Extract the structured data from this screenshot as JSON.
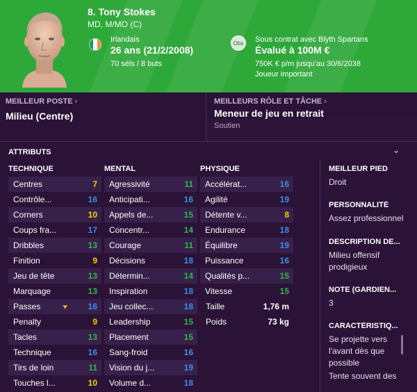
{
  "player": {
    "name": "8. Tony Stokes",
    "positions": "MD, M/MO (C)",
    "nationality": "Irlandais",
    "age": "26 ans (21/2/2008)",
    "caps": "70 séls / 8 buts",
    "obs_badge": "Obs",
    "contract": "Sous contrat avec Blyth Spartans",
    "value": "Évalué à 100M €",
    "wage": "750K € p/m jusqu'au 30/6/2038",
    "status": "Joueur important",
    "flag_colors": [
      "#169b62",
      "#ffffff",
      "#ff883e"
    ],
    "header_color": "#2fa83a"
  },
  "best_position": {
    "label": "MEILLEUR POSTE",
    "value": "Milieu (Centre)"
  },
  "best_role": {
    "label": "MEILLEURS RÔLE ET TÂCHE",
    "value": "Meneur de jeu en retrait",
    "duty": "Soutien"
  },
  "attributes": {
    "title": "ATTRIBUTS",
    "toggle_icon": "chevron-down-icon",
    "technique": {
      "header": "TECHNIQUE",
      "rows": [
        {
          "name": "Centres",
          "value": "7"
        },
        {
          "name": "Contrôle...",
          "value": "16"
        },
        {
          "name": "Corners",
          "value": "10"
        },
        {
          "name": "Coups fra...",
          "value": "17"
        },
        {
          "name": "Dribbles",
          "value": "13"
        },
        {
          "name": "Finition",
          "value": "9"
        },
        {
          "name": "Jeu de tête",
          "value": "13"
        },
        {
          "name": "Marquage",
          "value": "13"
        },
        {
          "name": "Passes",
          "value": "16"
        },
        {
          "name": "Penalty",
          "value": "9"
        },
        {
          "name": "Tacles",
          "value": "13"
        },
        {
          "name": "Technique",
          "value": "16"
        },
        {
          "name": "Tirs de loin",
          "value": "11"
        },
        {
          "name": "Touches l...",
          "value": "10"
        }
      ]
    },
    "mental": {
      "header": "MENTAL",
      "rows": [
        {
          "name": "Agressivité",
          "value": "11"
        },
        {
          "name": "Anticipati...",
          "value": "16"
        },
        {
          "name": "Appels de...",
          "value": "15"
        },
        {
          "name": "Concentr...",
          "value": "14"
        },
        {
          "name": "Courage",
          "value": "11"
        },
        {
          "name": "Décisions",
          "value": "18"
        },
        {
          "name": "Détermin...",
          "value": "14"
        },
        {
          "name": "Inspiration",
          "value": "18"
        },
        {
          "name": "Jeu collec...",
          "value": "18"
        },
        {
          "name": "Leadership",
          "value": "15"
        },
        {
          "name": "Placement",
          "value": "15"
        },
        {
          "name": "Sang-froid",
          "value": "16"
        },
        {
          "name": "Vision du j...",
          "value": "19"
        },
        {
          "name": "Volume d...",
          "value": "18"
        }
      ]
    },
    "physique": {
      "header": "PHYSIQUE",
      "rows": [
        {
          "name": "Accélérat...",
          "value": "16"
        },
        {
          "name": "Agilité",
          "value": "19"
        },
        {
          "name": "Détente v...",
          "value": "8"
        },
        {
          "name": "Endurance",
          "value": "18"
        },
        {
          "name": "Équilibre",
          "value": "19"
        },
        {
          "name": "Puissance",
          "value": "16"
        },
        {
          "name": "Qualités p...",
          "value": "15"
        },
        {
          "name": "Vitesse",
          "value": "15"
        }
      ],
      "height_label": "Taille",
      "height_value": "1,76 m",
      "weight_label": "Poids",
      "weight_value": "73 kg"
    }
  },
  "side_info": {
    "foot_label": "MEILLEUR PIED",
    "foot_value": "Droit",
    "personality_label": "PERSONNALITÉ",
    "personality_value": "Assez professionnel",
    "media_label": "DESCRIPTION DE...",
    "media_value": "Milieu offensif prodigieux",
    "rating_label": "NOTE (GARDIEN...",
    "rating_value": "3",
    "traits_label": "CARACTÉRISTIQ...",
    "traits": [
      "Se projette vers l'avant dès que possible",
      "Tente souvent des"
    ]
  },
  "value_colors": {
    "low": "#f0d000",
    "mid": "#2fb84a",
    "high": "#3d8ee6"
  }
}
